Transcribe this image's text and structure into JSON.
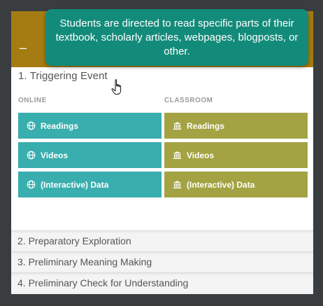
{
  "tooltip": {
    "text": "Students are directed to read specific parts of their textbook, scholarly articles, webpages, blogposts, or other."
  },
  "header": {
    "collapse_label": "–",
    "color": "#a57c11"
  },
  "section_1": {
    "title": "1. Triggering Event",
    "online_label": "ONLINE",
    "classroom_label": "CLASSROOM",
    "online_items": [
      {
        "label": "Readings",
        "icon": "globe-icon"
      },
      {
        "label": "Videos",
        "icon": "globe-icon"
      },
      {
        "label": "(Interactive) Data",
        "icon": "globe-icon"
      }
    ],
    "classroom_items": [
      {
        "label": "Readings",
        "icon": "building-icon"
      },
      {
        "label": "Videos",
        "icon": "building-icon"
      },
      {
        "label": "(Interactive) Data",
        "icon": "building-icon"
      }
    ],
    "online_color": "#39aeae",
    "classroom_color": "#a3a343"
  },
  "sections": [
    {
      "title": "2. Preparatory Exploration"
    },
    {
      "title": "3. Preliminary Meaning Making"
    },
    {
      "title": "4. Preliminary Check for Understanding"
    }
  ]
}
